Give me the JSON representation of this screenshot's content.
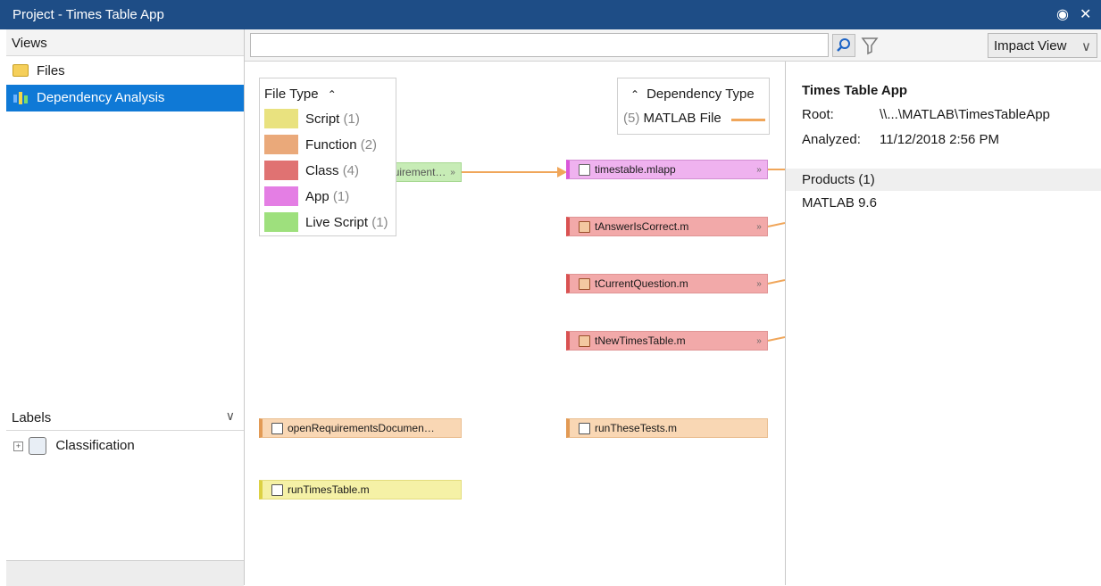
{
  "window": {
    "title": "Project - Times Table App"
  },
  "views": {
    "header": "Views",
    "items": [
      {
        "label": "Files",
        "icon": "folder-icon"
      },
      {
        "label": "Dependency Analysis",
        "icon": "dependency-graph-icon"
      }
    ]
  },
  "labels": {
    "header": "Labels",
    "items": [
      {
        "label": "Classification"
      }
    ]
  },
  "toolbar": {
    "search": {
      "value": "",
      "placeholder": ""
    },
    "view_select": "Impact View"
  },
  "legend_file_type": {
    "title": "File Type",
    "items": [
      {
        "name": "Script",
        "count": "(1)",
        "color": "#e9e27f"
      },
      {
        "name": "Function",
        "count": "(2)",
        "color": "#eaa97a"
      },
      {
        "name": "Class",
        "count": "(4)",
        "color": "#e07272"
      },
      {
        "name": "App",
        "count": "(1)",
        "color": "#e47ee4"
      },
      {
        "name": "Live Script",
        "count": "(1)",
        "color": "#9ee07d"
      }
    ]
  },
  "legend_dependency": {
    "title": "Dependency Type",
    "count": "(5)",
    "name": "MATLAB File",
    "color": "#f0a65a"
  },
  "graph": {
    "nodes": {
      "live": "openRequirement…",
      "app": "timestable.mlapp",
      "class1": "tAnswerIsCorrect.m",
      "class2": "tCurrentQuestion.m",
      "class3": "tNewTimesTable.m",
      "func1": "openRequirementsDocumen…",
      "func2": "runTheseTests.m",
      "script": "runTimesTable.m"
    }
  },
  "details": {
    "title": "Times Table App",
    "root_label": "Root:",
    "root_value": "\\\\...\\MATLAB\\TimesTableApp",
    "analyzed_label": "Analyzed:",
    "analyzed_value": "11/12/2018 2:56 PM",
    "products_header": "Products (1)",
    "products": [
      "MATLAB 9.6"
    ]
  }
}
